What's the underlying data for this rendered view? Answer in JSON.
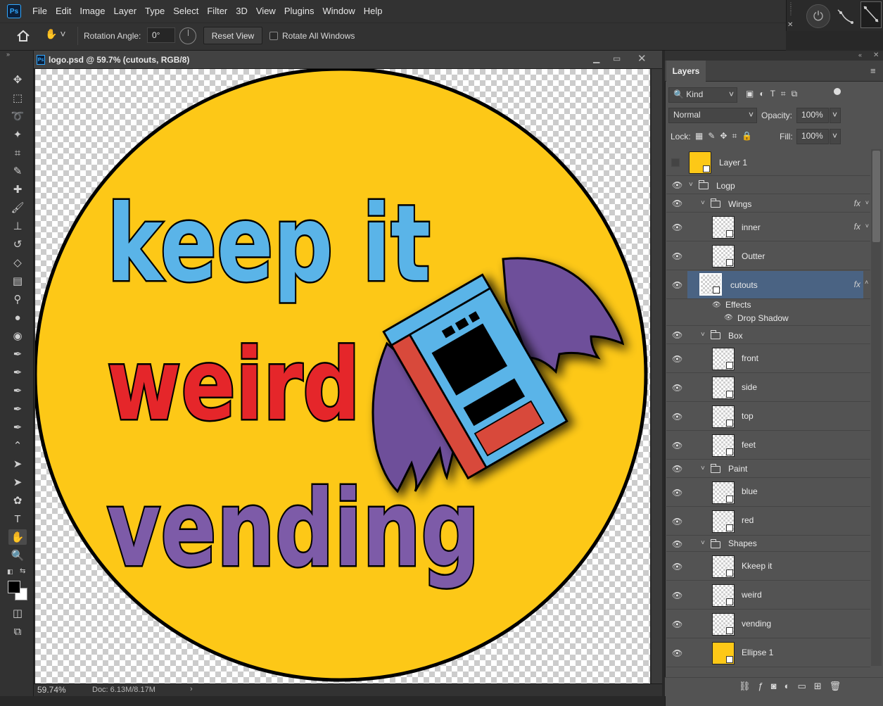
{
  "app": {
    "logo": "Ps"
  },
  "menu": [
    "File",
    "Edit",
    "Image",
    "Layer",
    "Type",
    "Select",
    "Filter",
    "3D",
    "View",
    "Plugins",
    "Window",
    "Help"
  ],
  "options": {
    "rotation_label": "Rotation Angle:",
    "rotation_value": "0°",
    "reset_label": "Reset View",
    "rotate_all_label": "Rotate All Windows",
    "rotate_all_checked": false
  },
  "document": {
    "title": "logo.psd @ 59.7% (cutouts, RGB/8)",
    "zoom": "59.74%",
    "doc_size": "Doc: 6.13M/8.17M"
  },
  "artwork": {
    "line1": "keep it",
    "line2": "weird",
    "line3": "vending",
    "colors": {
      "ellipse": "#fdc817",
      "line1": "#5ab4e8",
      "line2": "#e5262a",
      "line3": "#7d5ba8",
      "wings": "#6e4f9a",
      "outline": "#000000"
    }
  },
  "panel": {
    "tab": "Layers",
    "kind": "Kind",
    "blend_mode": "Normal",
    "opacity_label": "Opacity:",
    "opacity": "100%",
    "lock_label": "Lock:",
    "fill_label": "Fill:",
    "fill": "100%"
  },
  "layers": [
    {
      "name": "Layer 1",
      "visible": false,
      "type": "layer"
    },
    {
      "name": "Logp",
      "visible": true,
      "type": "group"
    },
    {
      "name": "Wings",
      "visible": true,
      "type": "group",
      "fx": "fx"
    },
    {
      "name": "inner",
      "visible": true,
      "type": "layer",
      "fx": "fx"
    },
    {
      "name": "Outter",
      "visible": true,
      "type": "layer"
    },
    {
      "name": "cutouts",
      "visible": true,
      "type": "layer",
      "fx": "fx",
      "selected": true
    },
    {
      "name": "Effects",
      "visible": true,
      "type": "effects"
    },
    {
      "name": "Drop Shadow",
      "visible": true,
      "type": "effect"
    },
    {
      "name": "Box",
      "visible": true,
      "type": "group"
    },
    {
      "name": "front",
      "visible": true,
      "type": "layer"
    },
    {
      "name": "side",
      "visible": true,
      "type": "layer"
    },
    {
      "name": "top",
      "visible": true,
      "type": "layer"
    },
    {
      "name": "feet",
      "visible": true,
      "type": "layer"
    },
    {
      "name": "Paint",
      "visible": true,
      "type": "group"
    },
    {
      "name": "blue",
      "visible": true,
      "type": "layer"
    },
    {
      "name": "red",
      "visible": true,
      "type": "layer"
    },
    {
      "name": "Shapes",
      "visible": true,
      "type": "group"
    },
    {
      "name": "Kkeep it",
      "visible": true,
      "type": "layer"
    },
    {
      "name": "weird",
      "visible": true,
      "type": "layer"
    },
    {
      "name": "vending",
      "visible": true,
      "type": "layer"
    },
    {
      "name": "Ellipse 1",
      "visible": true,
      "type": "layer"
    }
  ],
  "icons": {
    "home": "home-icon",
    "hand": "hand-tool-icon",
    "power": "power-icon",
    "fx": "fx-icon",
    "eye": "eye-icon",
    "folder": "folder-icon"
  }
}
